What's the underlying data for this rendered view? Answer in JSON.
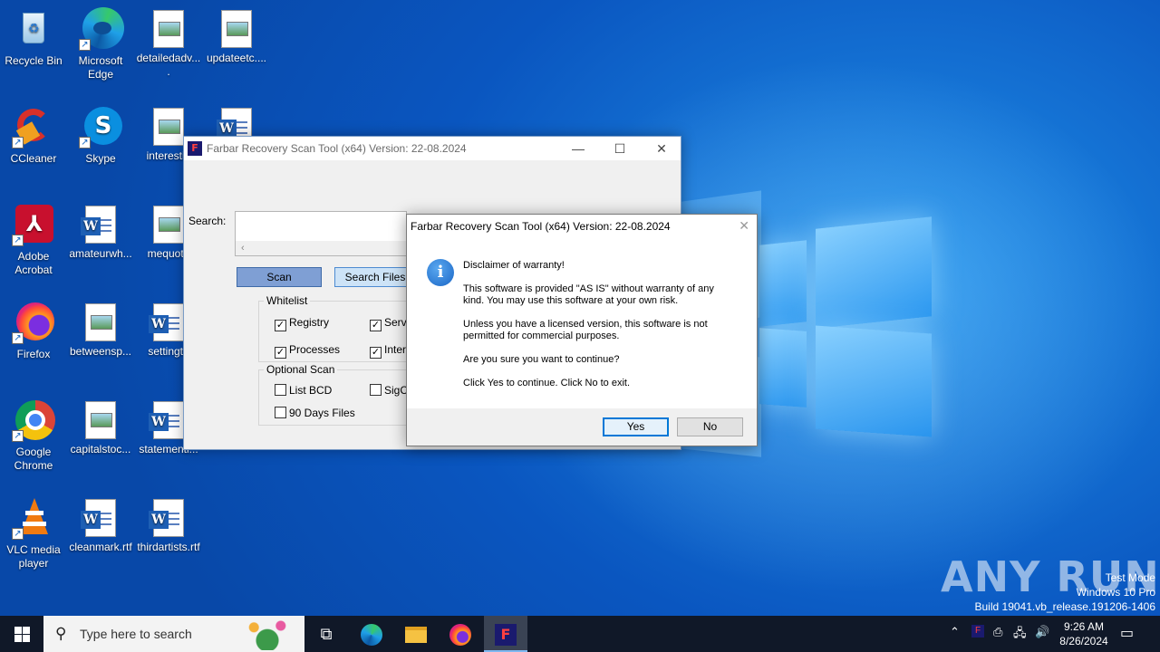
{
  "desktop": {
    "icons": [
      {
        "label": "Recycle Bin",
        "icon": "recycle-bin-icon"
      },
      {
        "label": "Microsoft Edge",
        "icon": "edge-icon"
      },
      {
        "label": "detailedadv....",
        "icon": "image-file-icon"
      },
      {
        "label": "updateetc....",
        "icon": "image-file-icon"
      },
      {
        "label": "CCleaner",
        "icon": "ccleaner-icon"
      },
      {
        "label": "Skype",
        "icon": "skype-icon"
      },
      {
        "label": "interestin",
        "icon": "image-file-icon"
      },
      {
        "label": "Adobe Acrobat",
        "icon": "acrobat-icon"
      },
      {
        "label": "amateurwh...",
        "icon": "word-file-icon"
      },
      {
        "label": "mequote",
        "icon": "image-file-icon"
      },
      {
        "label": "Firefox",
        "icon": "firefox-icon"
      },
      {
        "label": "betweensp...",
        "icon": "image-file-icon"
      },
      {
        "label": "settingtu",
        "icon": "word-file-icon"
      },
      {
        "label": "Google Chrome",
        "icon": "chrome-icon"
      },
      {
        "label": "capitalstoc...",
        "icon": "image-file-icon"
      },
      {
        "label": "statementi...",
        "icon": "word-file-icon"
      },
      {
        "label": "VLC media player",
        "icon": "vlc-icon"
      },
      {
        "label": "cleanmark.rtf",
        "icon": "word-file-icon"
      },
      {
        "label": "thirdartists.rtf",
        "icon": "word-file-icon"
      }
    ]
  },
  "frst_window": {
    "title": "Farbar Recovery Scan Tool (x64) Version: 22-08.2024",
    "search_label": "Search:",
    "scan_button": "Scan",
    "search_files_button": "Search Files",
    "whitelist": {
      "title": "Whitelist",
      "registry": "Registry",
      "services": "Servi",
      "processes": "Processes",
      "internet": "Intern"
    },
    "optional_scan": {
      "title": "Optional Scan",
      "list_bcd": "List BCD",
      "sigcheck": "SigCh",
      "days90": "90 Days Files"
    }
  },
  "dialog": {
    "title": "Farbar Recovery Scan Tool (x64) Version: 22-08.2024",
    "line1": "Disclaimer of warranty!",
    "line2": "This software is provided \"AS IS\" without warranty of any kind. You may use this software at your own risk.",
    "line3": "Unless you have a licensed version, this software is not permitted for commercial purposes.",
    "line4": "Are you sure you want to continue?",
    "line5": "Click Yes to continue. Click No to exit.",
    "yes": "Yes",
    "no": "No"
  },
  "watermark": {
    "brand": "ANY RUN",
    "line1": "Test Mode",
    "line2": "Windows 10 Pro",
    "line3": "Build 19041.vb_release.191206-1406"
  },
  "taskbar": {
    "search_placeholder": "Type here to search",
    "time": "9:26 AM",
    "date": "8/26/2024"
  }
}
